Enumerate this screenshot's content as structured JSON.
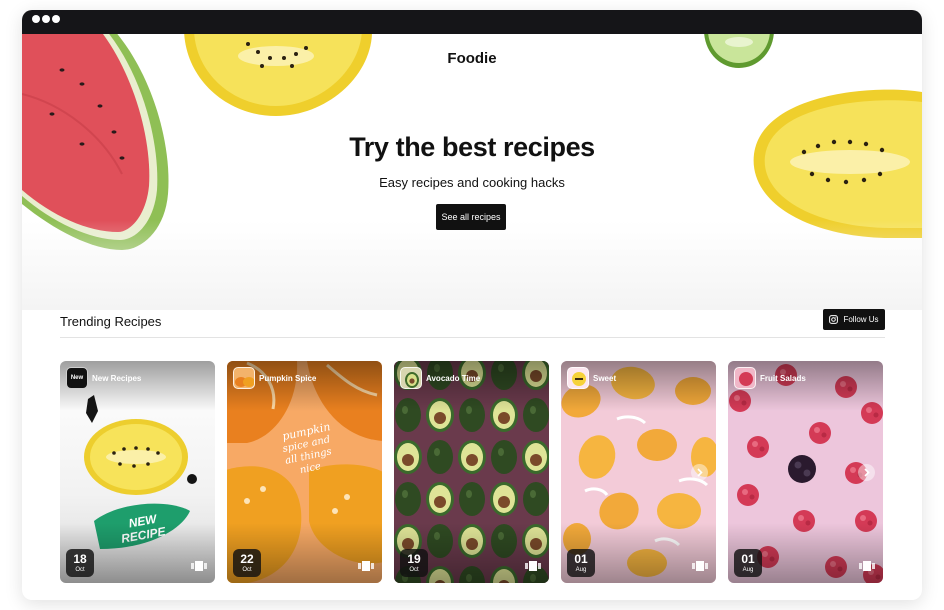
{
  "site": {
    "logo": "Foodie"
  },
  "hero": {
    "title": "Try the best recipes",
    "subtitle": "Easy recipes and cooking hacks",
    "cta_label": "See all recipes"
  },
  "trending": {
    "title": "Trending Recipes",
    "follow_label": "Follow Us",
    "cards": [
      {
        "title": "New Recipes",
        "avatar_text": "New",
        "day": "18",
        "month": "Oct",
        "sticker": "NEW RECIPE"
      },
      {
        "title": "Pumpkin Spice",
        "day": "22",
        "month": "Oct",
        "overlay_text": "pumpkin spice and all things nice"
      },
      {
        "title": "Avocado Time",
        "day": "19",
        "month": "Oct"
      },
      {
        "title": "Sweet",
        "day": "01",
        "month": "Aug"
      },
      {
        "title": "Fruit Salads",
        "day": "01",
        "month": "Aug"
      }
    ]
  },
  "colors": {
    "titlebar": "#151518",
    "button": "#111111",
    "sticker": "#1e9e6c"
  },
  "icons": {
    "window_controls": "dot-icon",
    "follow": "instagram-icon",
    "carousel": "carousel-icon",
    "next": "chevron-right-icon"
  }
}
